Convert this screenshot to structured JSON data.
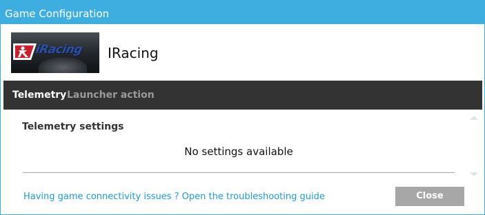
{
  "window": {
    "title": "Game Configuration"
  },
  "game": {
    "name": "IRacing",
    "thumbnail_icon": "iracing-logo-icon",
    "logo_text": "iRacing"
  },
  "tabs": [
    {
      "label": "Telemetry",
      "active": true
    },
    {
      "label": "Launcher action",
      "active": false
    }
  ],
  "telemetry": {
    "section_title": "Telemetry settings",
    "empty_message": "No settings available"
  },
  "footer": {
    "help_link": "Having game connectivity issues ? Open the troubleshooting guide",
    "close_label": "Close"
  },
  "colors": {
    "titlebar": "#3eaee1",
    "tabbar": "#333333",
    "link": "#1f9ad6",
    "close_button": "#a7a7a7"
  }
}
